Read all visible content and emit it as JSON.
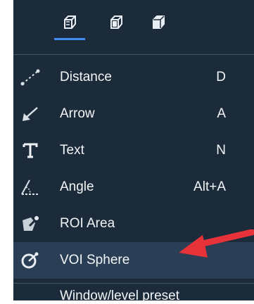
{
  "toolbar": {
    "buttons": [
      {
        "icon": "cube-outline-icon",
        "active": true
      },
      {
        "icon": "cube-front-icon",
        "active": false
      },
      {
        "icon": "cube-solid-icon",
        "active": false
      }
    ],
    "accent": "#3f8cf2"
  },
  "menu": {
    "items": [
      {
        "icon": "distance-icon",
        "label": "Distance",
        "shortcut": "D"
      },
      {
        "icon": "arrow-tool-icon",
        "label": "Arrow",
        "shortcut": "A"
      },
      {
        "icon": "text-tool-icon",
        "label": "Text",
        "shortcut": "N"
      },
      {
        "icon": "angle-icon",
        "label": "Angle",
        "shortcut": "Alt+A"
      },
      {
        "icon": "roi-area-icon",
        "label": "ROI Area",
        "shortcut": ""
      },
      {
        "icon": "voi-sphere-icon",
        "label": "VOI Sphere",
        "shortcut": ""
      }
    ],
    "next_item_label": "Window/level preset"
  },
  "annotation": {
    "pointer_color": "#e8323a"
  }
}
